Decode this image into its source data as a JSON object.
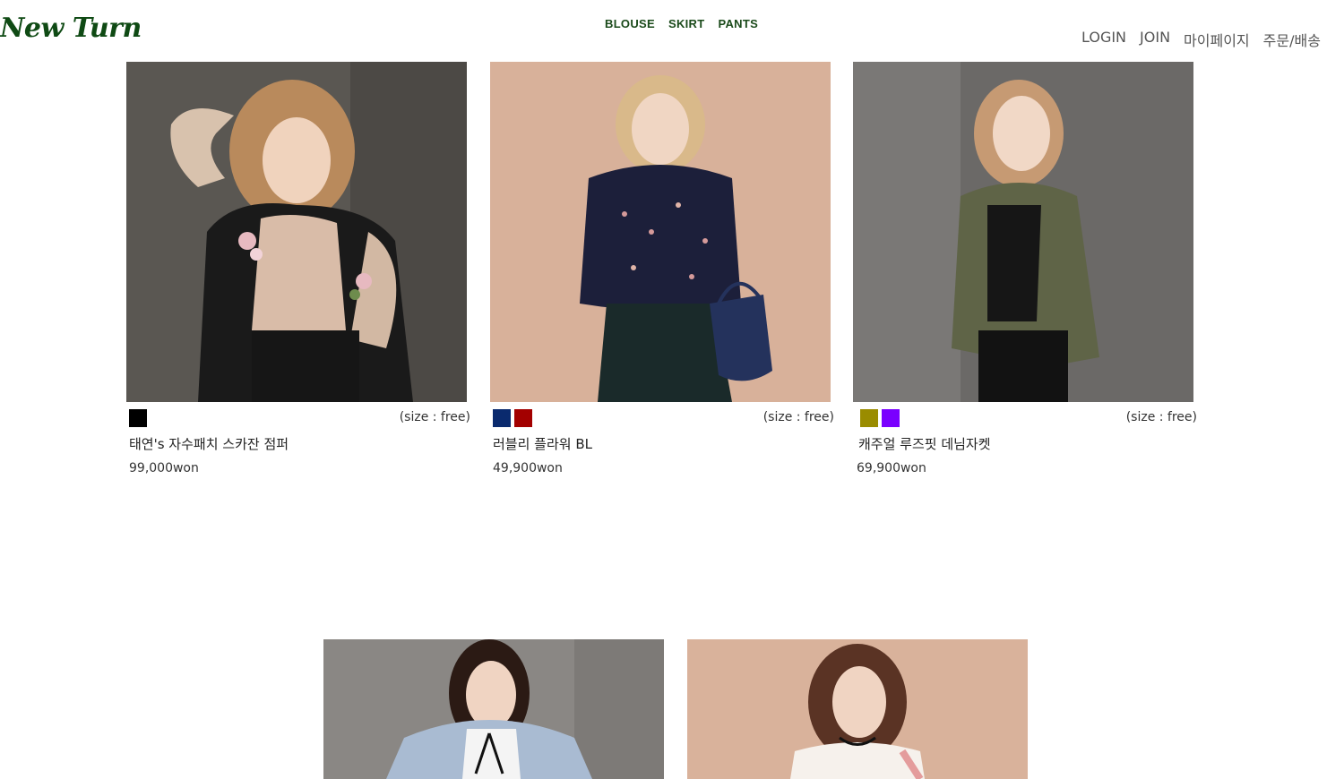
{
  "header": {
    "logo": "New Turn",
    "nav": [
      "BLOUSE",
      "SKIRT",
      "PANTS"
    ],
    "util": [
      "LOGIN",
      "JOIN",
      "마이페이지",
      "주문/배송"
    ]
  },
  "products": [
    {
      "name": "태연's 자수패치 스카잔 점퍼",
      "price": "99,000won",
      "size": "(size : free)",
      "colors": [
        "#000000"
      ]
    },
    {
      "name": "러블리 플라워 BL",
      "price": "49,900won",
      "size": "(size : free)",
      "colors": [
        "#0a2a6e",
        "#a30000"
      ]
    },
    {
      "name": "캐주얼 루즈핏 데님자켓",
      "price": "69,900won",
      "size": "(size : free)",
      "colors": [
        "#9a8c00",
        "#7a00ff"
      ]
    }
  ],
  "colors": {
    "logo": "#0f4a14",
    "nav": "#1a4a1a"
  }
}
